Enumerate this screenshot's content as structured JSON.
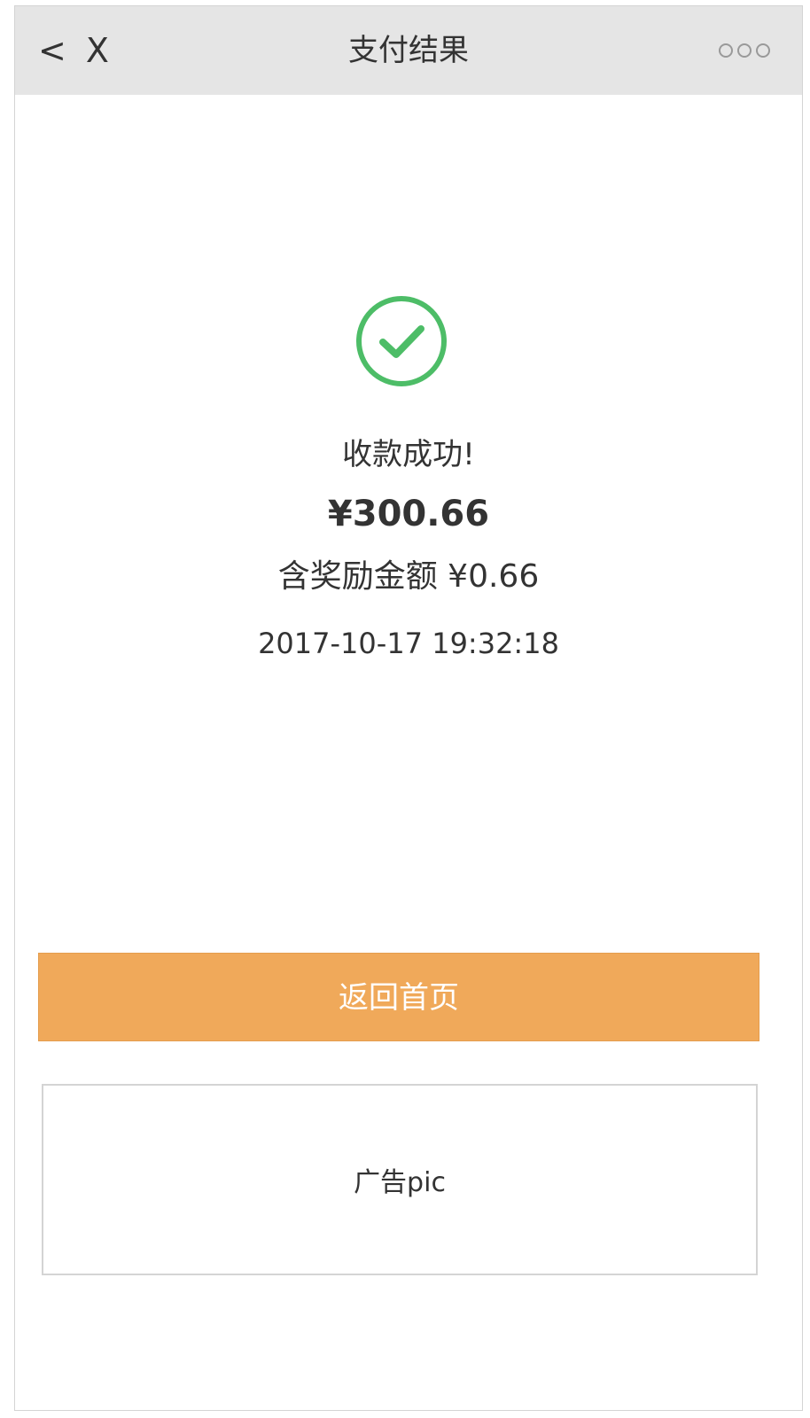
{
  "nav": {
    "back_label": "<",
    "close_label": "X",
    "title": "支付结果",
    "more_icon": "three-dots-icon"
  },
  "result": {
    "icon": "check-circle-icon",
    "icon_color": "#4dbd67",
    "status": "收款成功!",
    "amount": "¥300.66",
    "bonus": "含奖励金额 ¥0.66",
    "timestamp": "2017-10-17 19:32:18"
  },
  "actions": {
    "home_button_label": "返回首页",
    "home_button_color": "#f0a95a"
  },
  "ad": {
    "placeholder": "广告pic"
  }
}
